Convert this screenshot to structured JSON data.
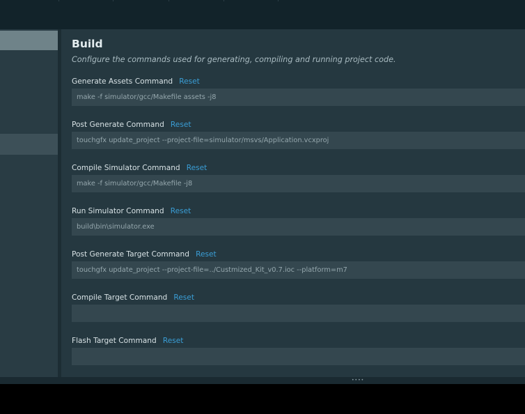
{
  "header": {
    "title": "Build",
    "description": "Configure the commands used for generating, compiling and running project code."
  },
  "reset_label": "Reset",
  "commands": [
    {
      "label": "Generate Assets Command",
      "value": "make -f simulator/gcc/Makefile assets -j8"
    },
    {
      "label": "Post Generate Command",
      "value": "touchgfx update_project --project-file=simulator/msvs/Application.vcxproj"
    },
    {
      "label": "Compile Simulator Command",
      "value": "make -f simulator/gcc/Makefile -j8"
    },
    {
      "label": "Run Simulator Command",
      "value": "build\\bin\\simulator.exe"
    },
    {
      "label": "Post Generate Target Command",
      "value": "touchgfx update_project --project-file=../Custmized_Kit_v0.7.ioc --platform=m7"
    },
    {
      "label": "Compile Target Command",
      "value": ""
    },
    {
      "label": "Flash Target Command",
      "value": ""
    }
  ],
  "resize_handle": "••••"
}
